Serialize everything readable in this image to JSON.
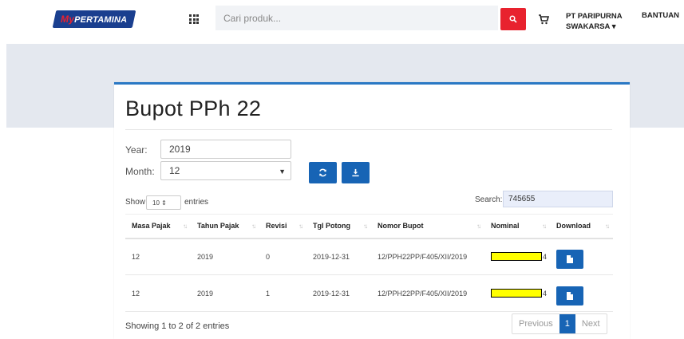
{
  "header": {
    "logo_my": "My",
    "logo_rest": "PERTAMINA",
    "search_placeholder": "Cari produk...",
    "company_line1": "PT PARIPURNA",
    "company_line2": "SWAKARSA ▾",
    "help_label": "BANTUAN"
  },
  "page": {
    "title": "Bupot PPh 22",
    "year_label": "Year:",
    "year_value": "2019",
    "month_label": "Month:",
    "month_value": "12",
    "show_label": "Show",
    "length_value": "10 ⇕",
    "entries_label": "entries",
    "search_label": "Search:",
    "search_value": "745655"
  },
  "table": {
    "columns": [
      "Masa Pajak",
      "Tahun Pajak",
      "Revisi",
      "Tgl Potong",
      "Nomor Bupot",
      "Nominal",
      "Download"
    ],
    "rows": [
      {
        "masa": "12",
        "tahun": "2019",
        "revisi": "0",
        "tgl": "2019-12-31",
        "nomor": "12/PPH22PP/F405/XII/2019",
        "nominal_tail": "4"
      },
      {
        "masa": "12",
        "tahun": "2019",
        "revisi": "1",
        "tgl": "2019-12-31",
        "nomor": "12/PPH22PP/F405/XII/2019",
        "nominal_tail": "4"
      }
    ]
  },
  "footer": {
    "info": "Showing 1 to 2 of 2 entries",
    "prev": "Previous",
    "page": "1",
    "next": "Next"
  },
  "colors": {
    "brand_red": "#e8222e",
    "primary_blue": "#1764b5",
    "card_accent": "#2a78c4",
    "highlight": "#ffff00"
  }
}
